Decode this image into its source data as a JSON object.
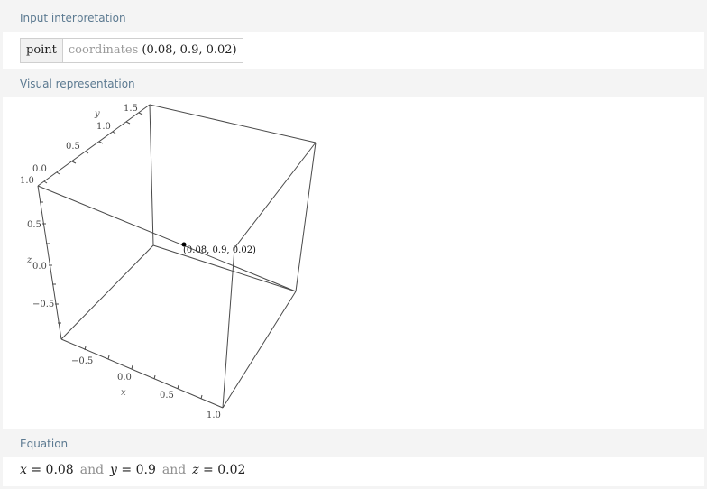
{
  "pods": {
    "input": {
      "title": "Input interpretation",
      "left_label": "point",
      "coord_word": "coordinates",
      "coord_value": "(0.08, 0.9, 0.02)"
    },
    "visual": {
      "title": "Visual representation",
      "point_label": "(0.08, 0.9, 0.02)",
      "axes": {
        "x_label": "x",
        "y_label": "y",
        "z_label": "z",
        "x_ticks": [
          "−0.5",
          "0.0",
          "0.5",
          "1.0"
        ],
        "y_ticks": [
          "0.0",
          "0.5",
          "1.0",
          "1.5"
        ],
        "z_ticks": [
          "1.0",
          "0.5",
          "0.0",
          "−0.5"
        ]
      },
      "colors": {
        "box_line": "#4a4a4a",
        "point": "#000000"
      }
    },
    "equation": {
      "title": "Equation",
      "x_var": "x",
      "x_rhs": " = 0.08",
      "and1": "and",
      "y_var": "y",
      "y_rhs": " = 0.9",
      "and2": "and",
      "z_var": "z",
      "z_rhs": " = 0.02"
    }
  }
}
